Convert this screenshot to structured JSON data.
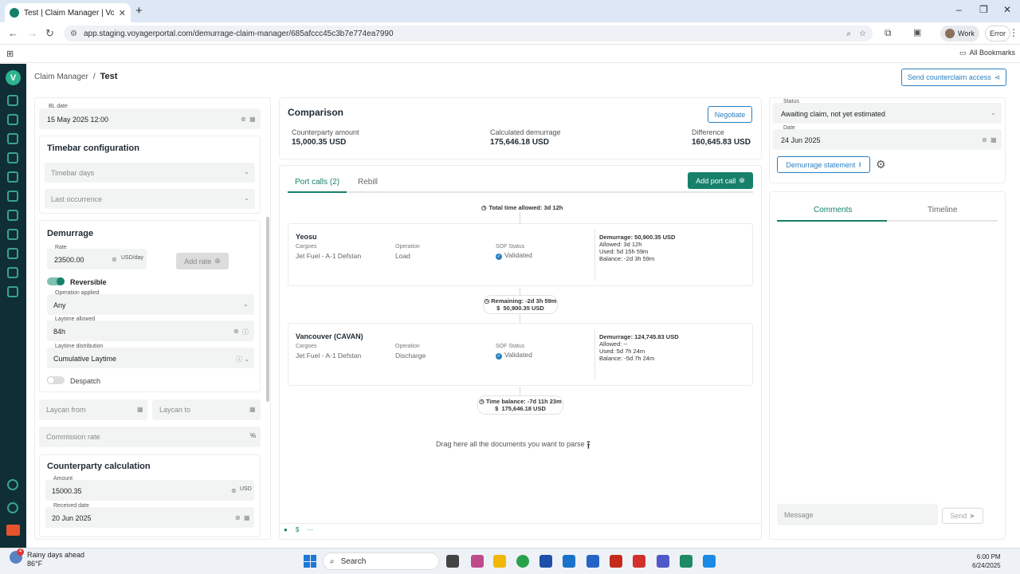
{
  "browser": {
    "tab_title": "Test | Claim Manager | Voyager",
    "new_tab": "+",
    "url": "app.staging.voyagerportal.com/demurrage-claim-manager/685afccc45c3b7e774ea7990",
    "profile": "Work",
    "error": "Error",
    "all_bookmarks": "All Bookmarks",
    "win_min": "–",
    "win_max": "❐",
    "win_close": "✕"
  },
  "header": {
    "crumb_root": "Claim Manager",
    "crumb_sep": "/",
    "crumb_current": "Test",
    "send_button": "Send counterclaim access"
  },
  "left": {
    "bl_date": {
      "label": "BL date",
      "value": "15 May 2025 12:00"
    },
    "timebar": {
      "title": "Timebar configuration",
      "days_placeholder": "Timebar days",
      "last_occurrence_placeholder": "Last occurrence"
    },
    "demurrage": {
      "title": "Demurrage",
      "rate_label": "Rate",
      "rate_value": "23500.00",
      "rate_unit": "USD/day",
      "add_rate": "Add rate",
      "reversible": "Reversible",
      "operation_label": "Operation applied",
      "operation_value": "Any",
      "laytime_label": "Laytime allowed",
      "laytime_value": "84h",
      "distribution_label": "Laytime distribution",
      "distribution_value": "Cumulative Laytime",
      "despatch": "Despatch"
    },
    "laycan_from": "Laycan from",
    "laycan_to": "Laycan to",
    "commission_rate": "Commission rate",
    "commission_unit": "%",
    "counterparty": {
      "title": "Counterparty calculation",
      "amount_label": "Amount",
      "amount_value": "15000.35",
      "amount_unit": "USD",
      "received_label": "Received date",
      "received_value": "20 Jun 2025"
    }
  },
  "comparison": {
    "title": "Comparison",
    "negotiate": "Negotiate",
    "counterparty_label": "Counterparty amount",
    "counterparty_value": "15,000.35 USD",
    "calculated_label": "Calculated demurrage",
    "calculated_value": "175,646.18 USD",
    "difference_label": "Difference",
    "difference_value": "160,645.83 USD"
  },
  "center": {
    "tab_port_calls": "Port calls (2)",
    "tab_rebill": "Rebill",
    "add_port_call": "Add port call",
    "total_allowed": "Total time allowed: 3d 12h",
    "ports": [
      {
        "name": "Yeosu",
        "cargoes_label": "Cargoes",
        "cargoes": "Jet Fuel - A-1 Defstan",
        "operation_label": "Operation",
        "operation": "Load",
        "sof_label": "SOF Status",
        "sof": "Validated",
        "demurrage": "Demurrage: 50,900.35 USD",
        "allowed": "Allowed: 3d 12h",
        "used": "Used: 5d 15h 59m",
        "balance": "Balance: -2d 3h 59m"
      },
      {
        "name": "Vancouver (CAVAN)",
        "cargoes_label": "Cargoes",
        "cargoes": "Jet Fuel - A-1 Defstan",
        "operation_label": "Operation",
        "operation": "Discharge",
        "sof_label": "SOF Status",
        "sof": "Validated",
        "demurrage": "Demurrage: 124,745.83 USD",
        "allowed": "Allowed: --",
        "used": "Used: 5d 7h 24m",
        "balance": "Balance: -5d 7h 24m"
      }
    ],
    "remaining": "Remaining: -2d 3h 59m",
    "remaining_amount": "50,900.35 USD",
    "time_balance": "Time balance: -7d 11h 23m",
    "balance_amount": "175,646.18 USD",
    "drag_text": "Drag here all the documents you want to parse"
  },
  "right": {
    "status_label": "Status",
    "status_value": "Awaiting claim, not yet estimated",
    "date_label": "Date",
    "date_value": "24 Jun 2025",
    "demurrage_statement": "Demurrage statement",
    "tab_comments": "Comments",
    "tab_timeline": "Timeline",
    "message_placeholder": "Message",
    "send": "Send"
  },
  "taskbar": {
    "weather_title": "Rainy days ahead",
    "weather_temp": "86°F",
    "weather_badge": "4",
    "search": "Search",
    "time": "6:00 PM",
    "date": "6/24/2025"
  },
  "colors": {
    "accent": "#17806a",
    "link": "#2b7fc0",
    "sidebar": "#0f2e35"
  }
}
